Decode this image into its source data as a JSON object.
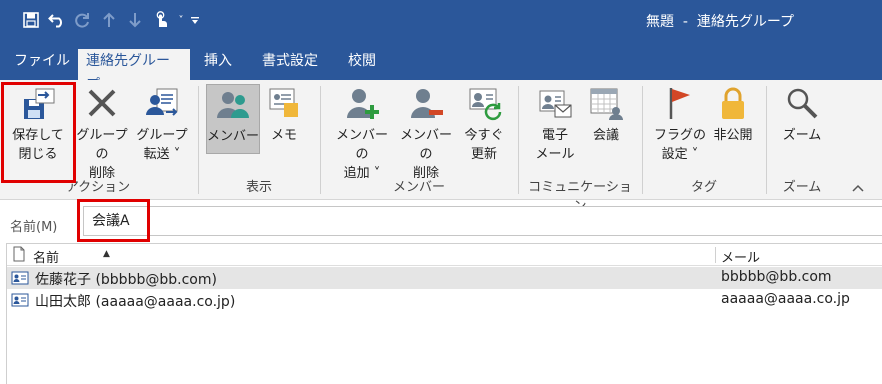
{
  "window": {
    "title": "無題  -  連絡先グループ"
  },
  "quick_access": {
    "icons": [
      "save-icon",
      "undo-icon",
      "redo-icon",
      "up-icon",
      "down-icon",
      "touch-mode-icon",
      "chevron-down-icon",
      "customize-icon"
    ]
  },
  "tabs": [
    {
      "label": "ファイル"
    },
    {
      "label": "連絡先グループ",
      "active": true
    },
    {
      "label": "挿入"
    },
    {
      "label": "書式設定"
    },
    {
      "label": "校閲"
    }
  ],
  "ribbon": {
    "groups": {
      "action": "アクション",
      "show": "表示",
      "members": "メンバー",
      "communication": "コミュニケーション",
      "tags": "タグ",
      "zoom": "ズーム"
    },
    "buttons": {
      "save_close": [
        "保存して",
        "閉じる"
      ],
      "delete_group": [
        "グループの",
        "削除"
      ],
      "forward_group": [
        "グループ",
        "転送 ˅"
      ],
      "members": "メンバー",
      "notes": "メモ",
      "add_members": [
        "メンバーの",
        "追加 ˅"
      ],
      "remove_member": [
        "メンバーの",
        "削除"
      ],
      "update_now": [
        "今すぐ",
        "更新"
      ],
      "email": [
        "電子",
        "メール"
      ],
      "meeting": "会議",
      "follow_up": [
        "フラグの",
        "設定 ˅"
      ],
      "private": "非公開",
      "zoom": "ズーム"
    }
  },
  "name_field": {
    "label": "名前(M)",
    "value": "会議A"
  },
  "list": {
    "headers": {
      "name": "名前",
      "email": "メール"
    },
    "rows": [
      {
        "name": "佐藤花子 (bbbbb@bb.com)",
        "email": "bbbbb@bb.com",
        "selected": true
      },
      {
        "name": "山田太郎 (aaaaa@aaaa.co.jp)",
        "email": "aaaaa@aaaa.co.jp",
        "selected": false
      }
    ]
  },
  "colors": {
    "accent": "#2b579a",
    "highlight": "#e00000",
    "ribbon_bg": "#f3f3f3"
  }
}
